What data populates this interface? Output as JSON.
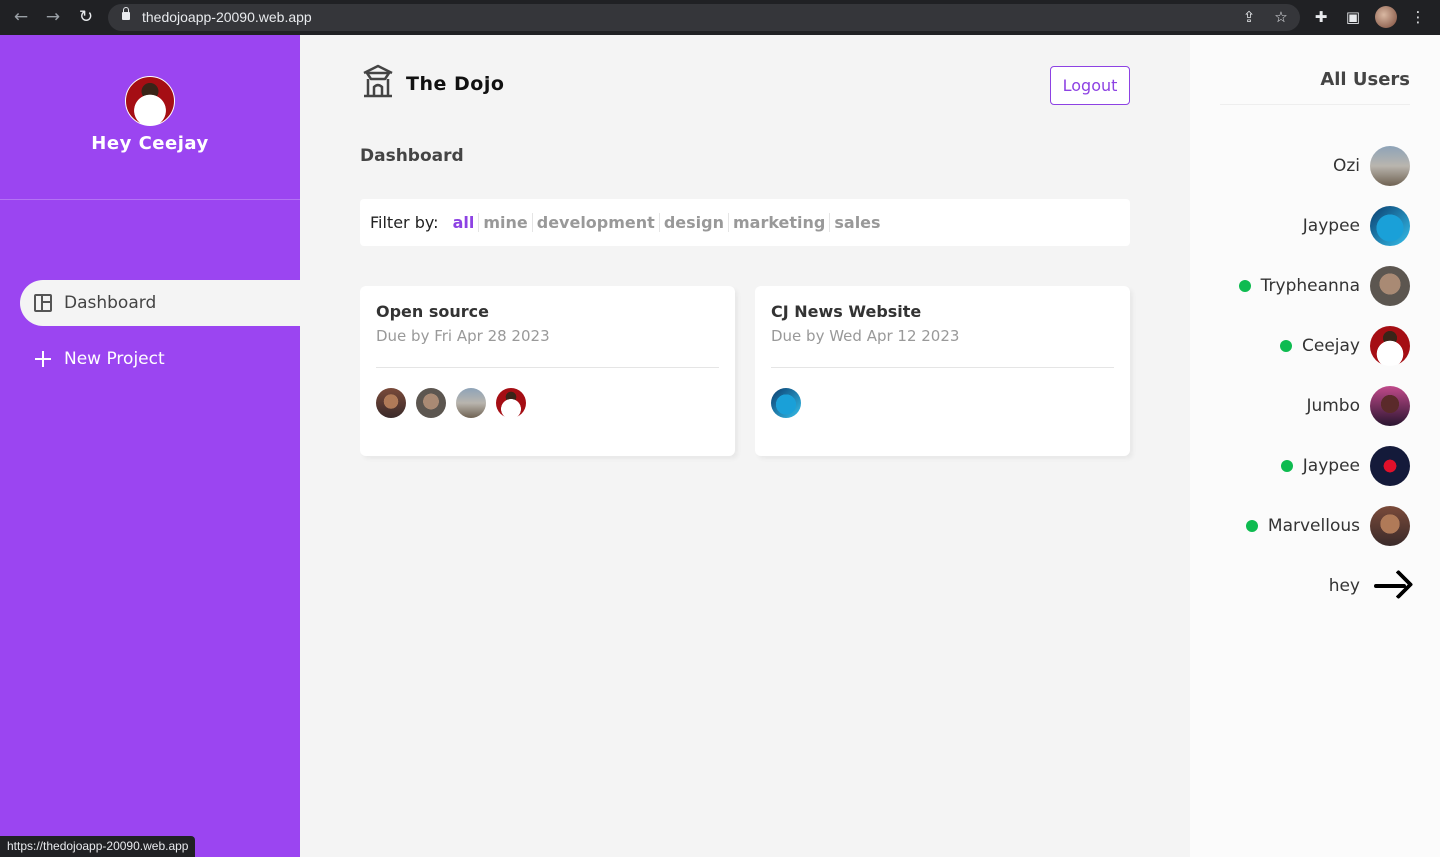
{
  "browser": {
    "url": "thedojoapp-20090.web.app",
    "status_url": "https://thedojoapp-20090.web.app"
  },
  "sidebar": {
    "greeting": "Hey Ceejay",
    "links": [
      {
        "label": "Dashboard",
        "icon": "dashboard-icon",
        "active": true
      },
      {
        "label": "New Project",
        "icon": "plus-icon",
        "active": false
      }
    ]
  },
  "header": {
    "brand": "The Dojo",
    "logout_label": "Logout"
  },
  "main": {
    "title": "Dashboard",
    "filter": {
      "label": "Filter by:",
      "options": [
        "all",
        "mine",
        "development",
        "design",
        "marketing",
        "sales"
      ],
      "selected": "all"
    },
    "projects": [
      {
        "name": "Open source",
        "due": "Due by Fri Apr 28 2023",
        "assigned_count": 4
      },
      {
        "name": "CJ News Website",
        "due": "Due by Wed Apr 12 2023",
        "assigned_count": 1
      }
    ]
  },
  "users_panel": {
    "title": "All Users",
    "users": [
      {
        "name": "Ozi",
        "online": false
      },
      {
        "name": "Jaypee",
        "online": false
      },
      {
        "name": "Trypheanna",
        "online": true
      },
      {
        "name": "Ceejay",
        "online": true
      },
      {
        "name": "Jumbo",
        "online": false
      },
      {
        "name": "Jaypee",
        "online": true
      },
      {
        "name": "Marvellous",
        "online": true
      },
      {
        "name": "hey",
        "online": false
      }
    ]
  },
  "colors": {
    "sidebar": "#9b45f1",
    "accent": "#8d42e3",
    "online": "#0ebb50"
  }
}
